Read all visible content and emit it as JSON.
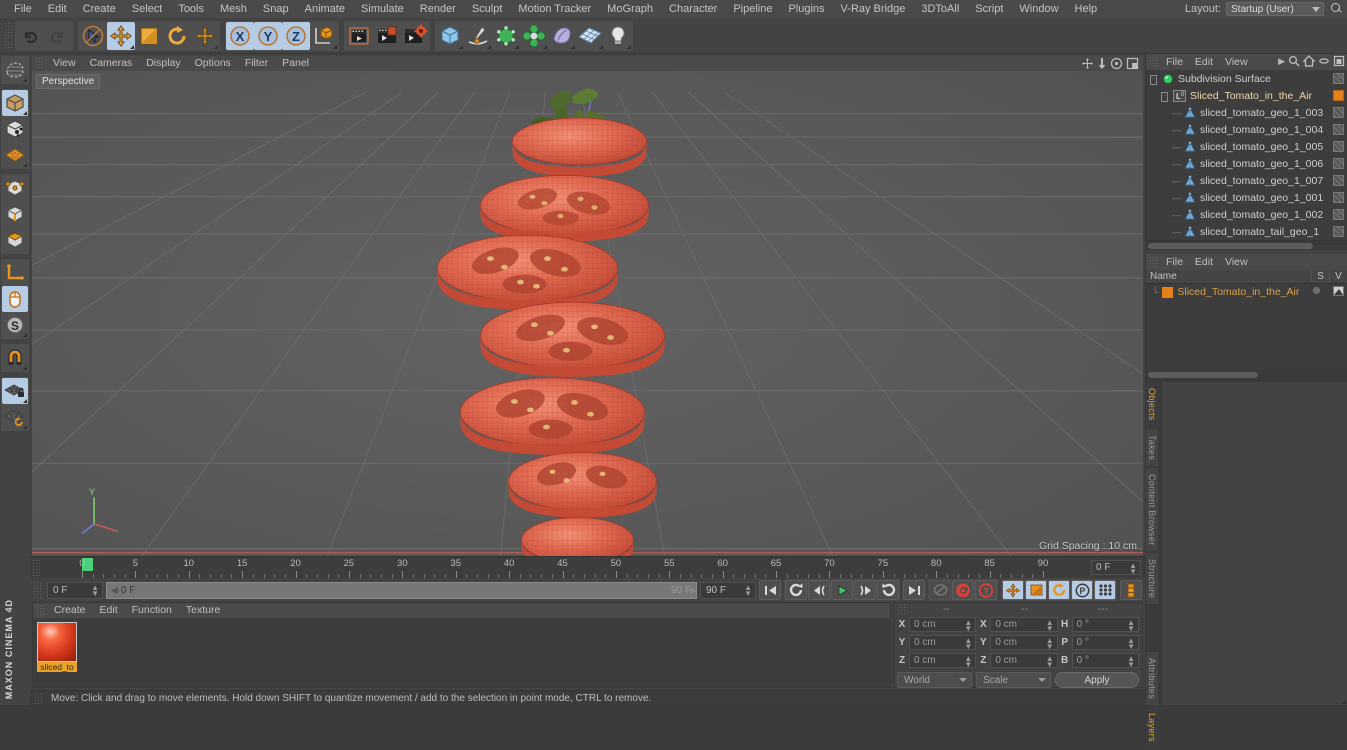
{
  "app": {
    "name": "CINEMA 4D",
    "vendor": "MAXON"
  },
  "menubar": {
    "items": [
      "File",
      "Edit",
      "Create",
      "Select",
      "Tools",
      "Mesh",
      "Snap",
      "Animate",
      "Simulate",
      "Render",
      "Sculpt",
      "Motion Tracker",
      "MoGraph",
      "Character",
      "Pipeline",
      "Plugins",
      "V-Ray Bridge",
      "3DToAll",
      "Script",
      "Window",
      "Help"
    ],
    "layout_label": "Layout:",
    "layout_value": "Startup (User)",
    "search_icon": "magnify-icon"
  },
  "toolbar": {
    "groups": [
      {
        "name": "history",
        "buttons": [
          {
            "name": "undo-button",
            "icon": "undo-arrow-icon",
            "selected": false
          },
          {
            "name": "redo-button",
            "icon": "redo-arrow-icon",
            "selected": false,
            "disabled": true
          }
        ]
      },
      {
        "name": "transform-tools",
        "buttons": [
          {
            "name": "select-tool",
            "icon": "cursor-select-icon",
            "selected": false
          },
          {
            "name": "move-tool",
            "icon": "move-arrows-icon",
            "selected": true
          },
          {
            "name": "scale-tool",
            "icon": "scale-square-icon",
            "selected": false
          },
          {
            "name": "rotate-tool",
            "icon": "rotate-circle-icon",
            "selected": false
          },
          {
            "name": "move-alt-tool",
            "icon": "move-cross-icon",
            "selected": false
          }
        ]
      },
      {
        "name": "axis-locks",
        "buttons": [
          {
            "name": "x-axis-lock",
            "icon": "x-axis-icon",
            "selected": true
          },
          {
            "name": "y-axis-lock",
            "icon": "y-axis-icon",
            "selected": true
          },
          {
            "name": "z-axis-lock",
            "icon": "z-axis-icon",
            "selected": true
          },
          {
            "name": "world-object-coordinates",
            "icon": "axis-cube-icon",
            "selected": false
          }
        ]
      },
      {
        "name": "render-group",
        "buttons": [
          {
            "name": "render-view-button",
            "icon": "render-clapper-icon",
            "selected": false
          },
          {
            "name": "render-region-button",
            "icon": "render-region-icon",
            "selected": false
          },
          {
            "name": "render-settings-button",
            "icon": "render-settings-icon",
            "selected": false
          }
        ]
      },
      {
        "name": "create-group",
        "buttons": [
          {
            "name": "add-cube-button",
            "icon": "cube-icon",
            "selected": false
          },
          {
            "name": "add-spline-button",
            "icon": "pen-spline-icon",
            "selected": false
          },
          {
            "name": "add-generator-button",
            "icon": "green-cube-generator-icon",
            "selected": false
          },
          {
            "name": "add-deformer-button",
            "icon": "green-deformer-icon",
            "selected": false
          },
          {
            "name": "add-scene-button",
            "icon": "environment-icon",
            "selected": false
          },
          {
            "name": "add-camera-button",
            "icon": "camera-icon",
            "selected": false
          },
          {
            "name": "add-light-button",
            "icon": "light-bulb-icon",
            "selected": false
          }
        ]
      }
    ]
  },
  "leftbar": {
    "groups": [
      [
        {
          "name": "live-selection-tool",
          "icon": "lasso-selection-icon",
          "selected": false
        }
      ],
      [
        {
          "name": "model-mode",
          "icon": "model-cube-icon",
          "selected": true
        },
        {
          "name": "object-mode",
          "icon": "object-cube-icon",
          "selected": false
        },
        {
          "name": "texture-mode",
          "icon": "texture-plane-icon",
          "selected": false
        }
      ],
      [
        {
          "name": "points-mode",
          "icon": "points-cube-icon",
          "selected": false
        },
        {
          "name": "edges-mode",
          "icon": "edges-cube-icon",
          "selected": false
        },
        {
          "name": "polygons-mode",
          "icon": "polygons-cube-icon",
          "selected": false
        }
      ],
      [
        {
          "name": "axis-modify-mode",
          "icon": "axis-l-icon",
          "selected": false
        },
        {
          "name": "viewport-solo-mode",
          "icon": "mouse-icon",
          "selected": true
        },
        {
          "name": "workplane-mode",
          "icon": "s-circle-icon",
          "selected": false
        }
      ],
      [
        {
          "name": "enable-snapping",
          "icon": "magnet-icon",
          "selected": false
        }
      ],
      [
        {
          "name": "lock-workplane",
          "icon": "grid-lock-icon",
          "selected": true
        },
        {
          "name": "workplane-reset",
          "icon": "grid-reset-icon",
          "selected": false
        }
      ]
    ]
  },
  "viewport": {
    "menu": [
      "View",
      "Cameras",
      "Display",
      "Options",
      "Filter",
      "Panel"
    ],
    "label": "Perspective",
    "grid_spacing": "Grid Spacing : 10 cm",
    "nav_icons": [
      "pan-icon",
      "zoom-icon",
      "orbit-icon",
      "maximize-icon"
    ],
    "scene_description": "Sliced tomato stack floating in the air over a perspective grid",
    "colors": {
      "tomato": "#e2604e",
      "grid": "#6c6c6c",
      "background": "#585858",
      "x_axis": "#c45a5a",
      "y_axis": "#6a7fd0"
    }
  },
  "timeline": {
    "start": 0,
    "end": 90,
    "major_step": 5,
    "labels": [
      "0",
      "5",
      "10",
      "15",
      "20",
      "25",
      "30",
      "35",
      "40",
      "45",
      "50",
      "55",
      "60",
      "65",
      "70",
      "75",
      "80",
      "85",
      "90"
    ],
    "current_frame_field": "0 F",
    "playhead_frame": 0
  },
  "playbar": {
    "current_frame": "0 F",
    "range_start": "0 F",
    "range_end_ghost": "90 F",
    "range_end": "90 F",
    "buttons": [
      {
        "name": "go-to-start-button",
        "icon": "skip-start-icon"
      },
      {
        "name": "go-to-previous-key-button",
        "icon": "prev-key-icon"
      },
      {
        "name": "step-back-button",
        "icon": "step-back-icon"
      },
      {
        "name": "play-button",
        "icon": "play-icon"
      },
      {
        "name": "step-forward-button",
        "icon": "step-forward-icon"
      },
      {
        "name": "go-to-next-key-button",
        "icon": "next-key-icon"
      },
      {
        "name": "go-to-end-button",
        "icon": "skip-end-icon"
      },
      {
        "name": "loop-playback-button",
        "icon": "loop-disabled-icon"
      },
      {
        "name": "record-active-objects-button",
        "icon": "record-icon"
      },
      {
        "name": "autokeying-button",
        "icon": "autokey-question-icon"
      },
      {
        "name": "record-position-button",
        "icon": "key-position-icon"
      },
      {
        "name": "record-scale-button",
        "icon": "key-scale-icon"
      },
      {
        "name": "record-rotation-button",
        "icon": "key-rotation-icon"
      },
      {
        "name": "record-parameter-button",
        "icon": "key-parameter-icon"
      },
      {
        "name": "record-pla-button",
        "icon": "key-pla-icon"
      },
      {
        "name": "keyframe-selection-button",
        "icon": "keyframe-selection-icon"
      }
    ]
  },
  "material_manager": {
    "menu": [
      "Create",
      "Edit",
      "Function",
      "Texture"
    ],
    "materials": [
      {
        "name": "sliced_to",
        "label": "sliced_to",
        "color": "#e8502a"
      }
    ]
  },
  "coordinates": {
    "headers": [
      "--",
      "--",
      "---"
    ],
    "position": [
      {
        "axis": "X",
        "value": "0 cm"
      },
      {
        "axis": "Y",
        "value": "0 cm"
      },
      {
        "axis": "Z",
        "value": "0 cm"
      }
    ],
    "size": [
      {
        "axis": "X",
        "value": "0 cm"
      },
      {
        "axis": "Y",
        "value": "0 cm"
      },
      {
        "axis": "Z",
        "value": "0 cm"
      }
    ],
    "rotation": [
      {
        "axis": "H",
        "value": "0 °"
      },
      {
        "axis": "P",
        "value": "0 °"
      },
      {
        "axis": "B",
        "value": "0 °"
      }
    ],
    "system": "World",
    "mode": "Scale",
    "apply_label": "Apply"
  },
  "statusbar": {
    "message": "Move: Click and drag to move elements. Hold down SHIFT to quantize movement / add to the selection in point mode, CTRL to remove."
  },
  "object_manager": {
    "menu": [
      "File",
      "Edit",
      "View"
    ],
    "icons": [
      "chevron-right-icon",
      "search-icon",
      "home-icon",
      "minimize-icon",
      "fit-icon"
    ],
    "tree": [
      {
        "label": "Subdivision Surface",
        "indent": 0,
        "icon": "subdivision-surface-icon",
        "tag": "checker"
      },
      {
        "label": "Sliced_Tomato_in_the_Air",
        "indent": 1,
        "icon": "null-layer-icon",
        "tag": "orange",
        "selected": true
      },
      {
        "label": "sliced_tomato_geo_1_003",
        "indent": 2,
        "icon": "polygon-object-icon",
        "tag": "checker"
      },
      {
        "label": "sliced_tomato_geo_1_004",
        "indent": 2,
        "icon": "polygon-object-icon",
        "tag": "checker"
      },
      {
        "label": "sliced_tomato_geo_1_005",
        "indent": 2,
        "icon": "polygon-object-icon",
        "tag": "checker"
      },
      {
        "label": "sliced_tomato_geo_1_006",
        "indent": 2,
        "icon": "polygon-object-icon",
        "tag": "checker"
      },
      {
        "label": "sliced_tomato_geo_1_007",
        "indent": 2,
        "icon": "polygon-object-icon",
        "tag": "checker"
      },
      {
        "label": "sliced_tomato_geo_1_001",
        "indent": 2,
        "icon": "polygon-object-icon",
        "tag": "checker"
      },
      {
        "label": "sliced_tomato_geo_1_002",
        "indent": 2,
        "icon": "polygon-object-icon",
        "tag": "checker"
      },
      {
        "label": "sliced_tomato_tail_geo_1",
        "indent": 2,
        "icon": "polygon-object-icon",
        "tag": "checker"
      }
    ]
  },
  "layer_manager": {
    "menu": [
      "File",
      "Edit",
      "View"
    ],
    "columns": {
      "name": "Name",
      "s": "S",
      "v": "V"
    },
    "rows": [
      {
        "label": "Sliced_Tomato_in_the_Air",
        "color": "#e8801a"
      }
    ]
  },
  "right_tabs": {
    "top": [
      "Objects",
      "Takes",
      "Content Browser",
      "Structure"
    ],
    "bottom": [
      "Attributes",
      "Layers"
    ],
    "active_top": "Objects",
    "active_bottom": "Layers"
  }
}
